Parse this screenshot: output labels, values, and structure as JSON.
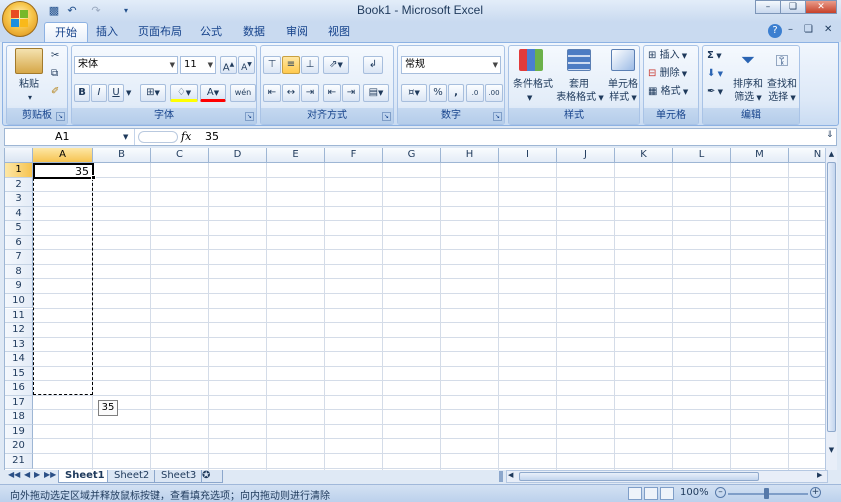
{
  "window": {
    "title": "Book1 - Microsoft Excel"
  },
  "quick_access": {
    "save_icon": "save-icon",
    "undo_icon": "undo-icon",
    "redo_icon": "redo-icon",
    "customize_icon": "customize-icon"
  },
  "tabs": [
    "开始",
    "插入",
    "页面布局",
    "公式",
    "数据",
    "审阅",
    "视图"
  ],
  "active_tab": "开始",
  "ribbon": {
    "clipboard": {
      "label": "剪贴板",
      "paste": "粘贴"
    },
    "font": {
      "label": "字体",
      "font_name": "宋体",
      "font_size": "11",
      "bold": "B",
      "italic": "I",
      "underline": "U",
      "fill_color": "#ffff00",
      "font_color": "#ff0000",
      "phonetic": "wén"
    },
    "alignment": {
      "label": "对齐方式"
    },
    "number": {
      "label": "数字",
      "format": "常规",
      "percent": "%",
      "comma": ",",
      "inc_decimal": ".0",
      "dec_decimal": ".00"
    },
    "styles": {
      "label": "样式",
      "conditional_line1": "条件格式",
      "table_line1": "套用",
      "table_line2": "表格格式",
      "cell_style_line1": "单元格",
      "cell_style_line2": "样式"
    },
    "cells": {
      "label": "单元格",
      "insert": "插入",
      "delete": "删除",
      "format": "格式"
    },
    "editing": {
      "label": "编辑",
      "sort_line1": "排序和",
      "sort_line2": "筛选",
      "find_line1": "查找和",
      "find_line2": "选择",
      "sum_symbol": "Σ"
    }
  },
  "formula_bar": {
    "name_box": "A1",
    "fx": "fx",
    "value": "35"
  },
  "grid": {
    "columns": [
      "A",
      "B",
      "C",
      "D",
      "E",
      "F",
      "G",
      "H",
      "I",
      "J",
      "K",
      "L",
      "M",
      "N"
    ],
    "rows": [
      "1",
      "2",
      "3",
      "4",
      "5",
      "6",
      "7",
      "8",
      "9",
      "10",
      "11",
      "12",
      "13",
      "14",
      "15",
      "16",
      "17",
      "18",
      "19",
      "20",
      "21"
    ],
    "cell_a1": "35",
    "fill_tooltip": "35"
  },
  "sheets": [
    "Sheet1",
    "Sheet2",
    "Sheet3"
  ],
  "active_sheet": "Sheet1",
  "status": {
    "message": "向外拖动选定区域并释放鼠标按键，查看填充选项；向内拖动则进行清除",
    "zoom": "100%"
  }
}
